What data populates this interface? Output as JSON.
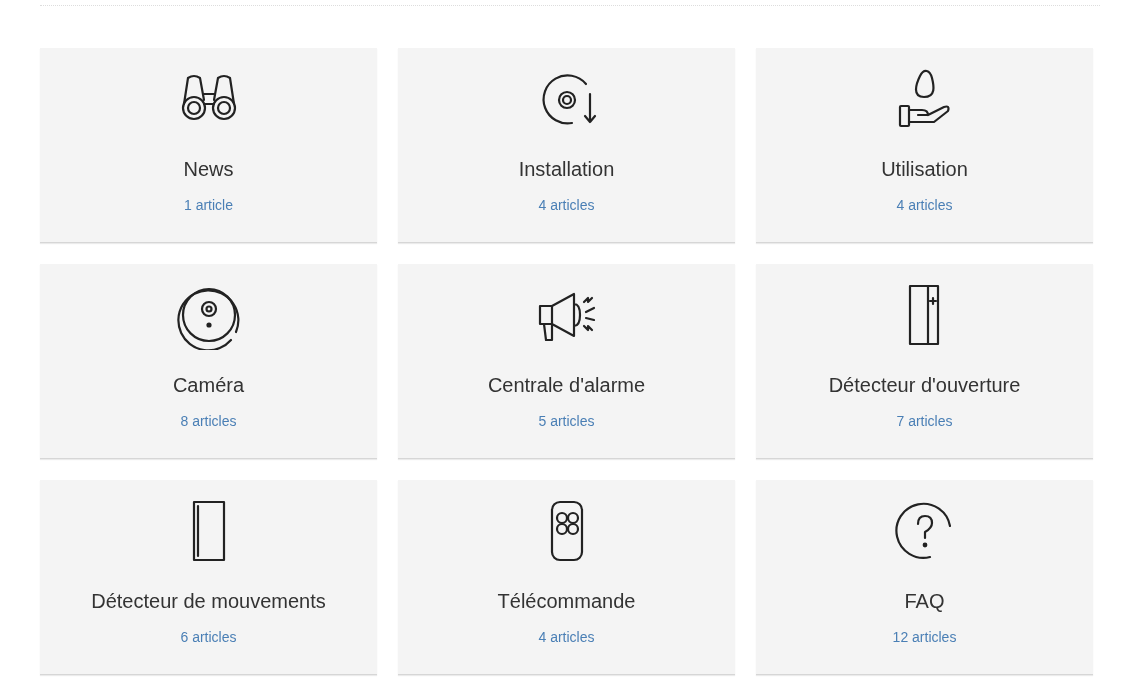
{
  "categories": [
    {
      "kind": "binoculars",
      "title": "News",
      "count": "1 article"
    },
    {
      "kind": "disc",
      "title": "Installation",
      "count": "4 articles"
    },
    {
      "kind": "hand",
      "title": "Utilisation",
      "count": "4 articles"
    },
    {
      "kind": "camera",
      "title": "Caméra",
      "count": "8 articles"
    },
    {
      "kind": "megaphone",
      "title": "Centrale d'alarme",
      "count": "5 articles"
    },
    {
      "kind": "door",
      "title": "Détecteur d'ouverture",
      "count": "7 articles"
    },
    {
      "kind": "sensor",
      "title": "Détecteur de mouvements",
      "count": "6 articles"
    },
    {
      "kind": "remote",
      "title": "Télécommande",
      "count": "4 articles"
    },
    {
      "kind": "question",
      "title": "FAQ",
      "count": "12 articles"
    }
  ]
}
